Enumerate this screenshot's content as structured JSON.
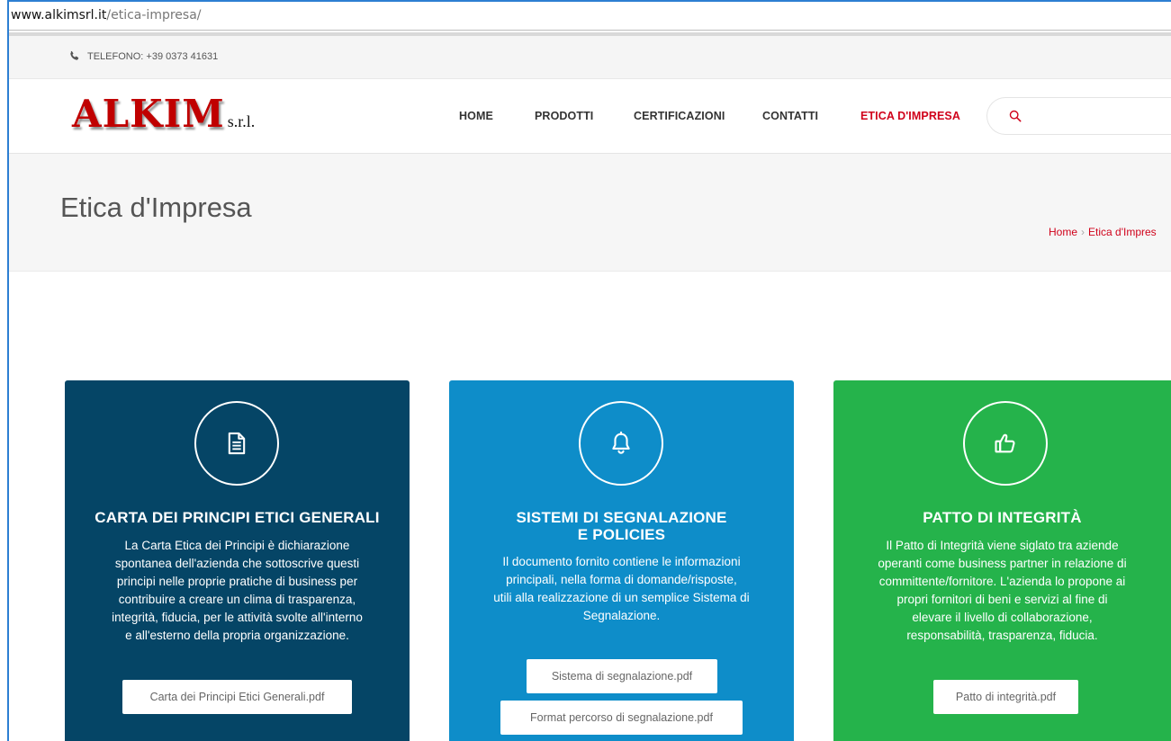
{
  "browser": {
    "url_host": "www.alkimsrl.it",
    "url_path": "/etica-impresa/"
  },
  "topbar": {
    "phone": "TELEFONO:  +39 0373 41631"
  },
  "logo": {
    "name": "ALKIM",
    "suffix": "s.r.l."
  },
  "nav": {
    "items": [
      {
        "label": "HOME"
      },
      {
        "label": "PRODOTTI"
      },
      {
        "label": "CERTIFICAZIONI"
      },
      {
        "label": "CONTATTI"
      },
      {
        "label": "ETICA D'IMPRESA"
      }
    ]
  },
  "page": {
    "title": "Etica d'Impresa",
    "breadcrumb": {
      "home": "Home",
      "separator": "›",
      "current": "Etica d'Impres"
    }
  },
  "cards": [
    {
      "icon": "document-icon",
      "title": "CARTA DEI PRINCIPI ETICI GENERALI",
      "text_lines": [
        "La Carta Etica dei Principi è dichiarazione",
        "spontanea dell'azienda che sottoscrive questi",
        "principi nelle proprie pratiche di business per",
        "contribuire a creare un clima di trasparenza,",
        "integrità, fiducia, per le attività svolte all'interno",
        "e all'esterno della propria organizzazione."
      ],
      "buttons": [
        "Carta dei Principi Etici Generali.pdf"
      ],
      "color": "#054566"
    },
    {
      "icon": "bell-icon",
      "title_lines": [
        "SISTEMI DI SEGNALAZIONE",
        "E POLICIES"
      ],
      "text_lines": [
        "Il documento fornito contiene le informazioni",
        "principali, nella forma di domande/risposte,",
        "utili alla realizzazione di un semplice Sistema di",
        "Segnalazione."
      ],
      "buttons": [
        "Sistema di segnalazione.pdf",
        "Format percorso di segnalazione.pdf"
      ],
      "color": "#0e8dc9"
    },
    {
      "icon": "thumbs-up-icon",
      "title": "PATTO DI INTEGRITÀ",
      "text_lines": [
        "Il Patto di Integrità viene siglato tra aziende",
        "operanti come business partner in relazione di",
        "committente/fornitore. L'azienda lo propone ai",
        "propri fornitori di beni e servizi al fine di",
        "elevare il livello di collaborazione,",
        "responsabilità, trasparenza, fiducia."
      ],
      "buttons": [
        "Patto di integrità.pdf"
      ],
      "color": "#25b34b"
    }
  ],
  "colors": {
    "accent_red": "#d0021b",
    "frame_blue": "#2d7fd2"
  }
}
